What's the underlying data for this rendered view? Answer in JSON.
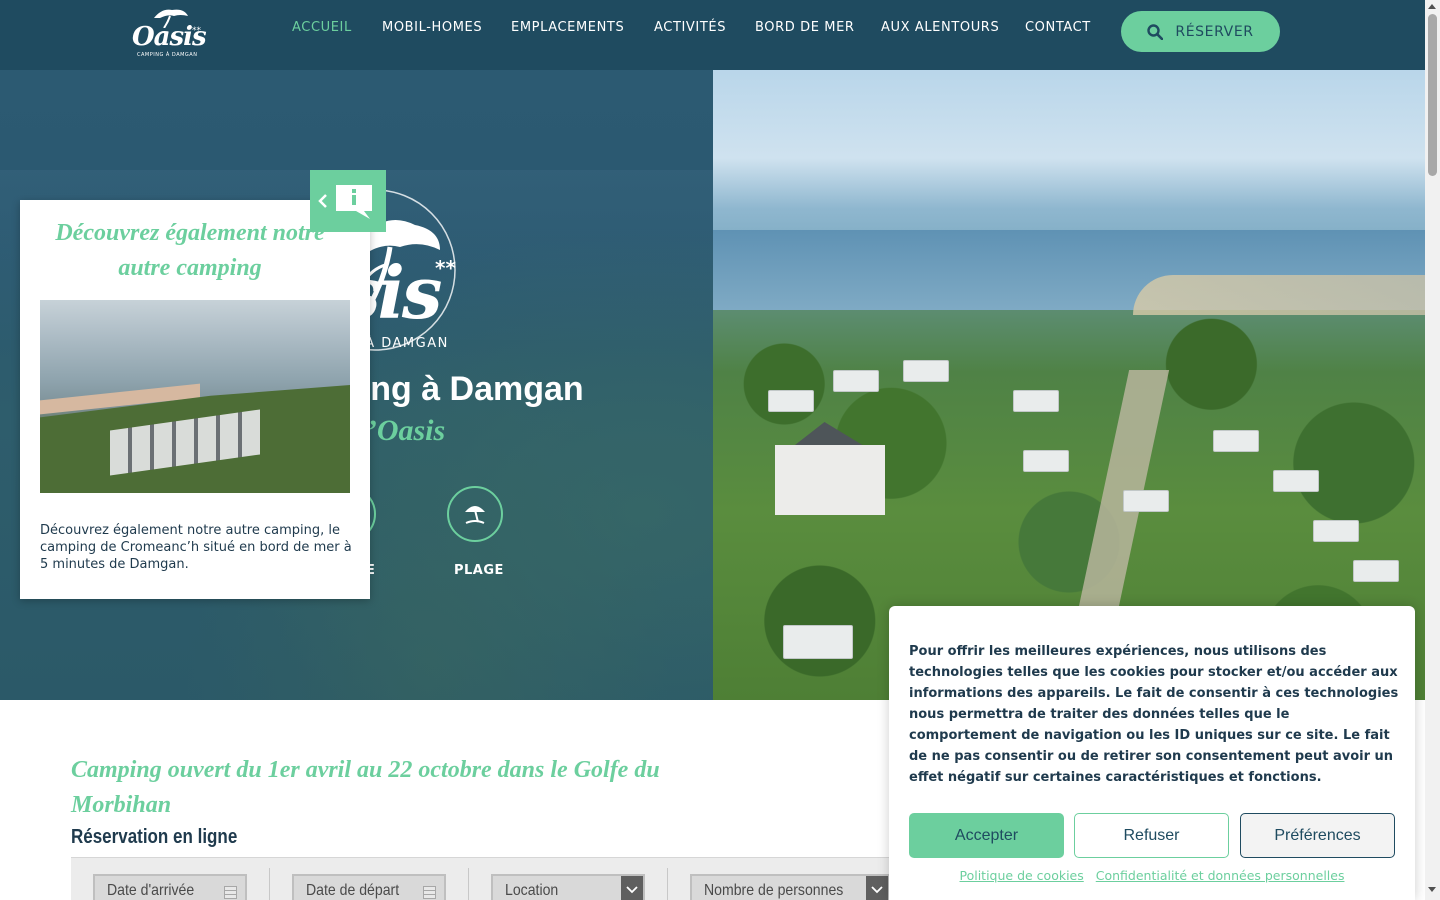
{
  "header": {
    "logo": {
      "word": "Oasis",
      "stars": "**",
      "sub": "CAMPING À DAMGAN"
    },
    "nav": [
      {
        "label": "ACCUEIL",
        "active": true
      },
      {
        "label": "MOBIL-HOMES",
        "active": false
      },
      {
        "label": "EMPLACEMENTS",
        "active": false
      },
      {
        "label": "ACTIVITÉS",
        "active": false
      },
      {
        "label": "BORD DE MER",
        "active": false
      },
      {
        "label": "AUX ALENTOURS",
        "active": false
      },
      {
        "label": "CONTACT",
        "active": false
      }
    ],
    "reserve_label": "RÉSERVER",
    "reserve_icon": "search-icon"
  },
  "hero": {
    "logo_word": "sis",
    "logo_stars": "**",
    "logo_sub": "G À DAMGAN",
    "title": "ping à Damgan",
    "subtitle": "g l’Oasis",
    "features": [
      {
        "label": "E",
        "icon": "partial-icon"
      },
      {
        "label": "PLAGE",
        "icon": "beach-umbrella-icon"
      }
    ]
  },
  "popup": {
    "title": "Découvrez également notre autre camping",
    "text": "Découvrez également notre autre camping, le camping de Cromeanc’h situé en bord de mer à 5 minutes de Damgan.",
    "toggle_icons": [
      "chevron-left-icon",
      "info-bubble-icon"
    ]
  },
  "main": {
    "open_text": "Camping ouvert du 1er avril au 22 octobre dans le Golfe du Morbihan",
    "booking_title": "Réservation en ligne",
    "booking_fields": [
      {
        "label": "Date d'arrivée",
        "icon": "calendar-icon"
      },
      {
        "label": "Date de départ",
        "icon": "calendar-icon"
      },
      {
        "label": "Location",
        "icon": "chevron-down-icon"
      },
      {
        "label": "Nombre de personnes",
        "icon": "chevron-down-icon"
      }
    ]
  },
  "cookie": {
    "text": "Pour offrir les meilleures expériences, nous utilisons des technologies telles que les cookies pour stocker et/ou accéder aux informations des appareils. Le fait de consentir à ces technologies nous permettra de traiter des données telles que le comportement de navigation ou les ID uniques sur ce site. Le fait de ne pas consentir ou de retirer son consentement peut avoir un effet négatif sur certaines caractéristiques et fonctions.",
    "accept": "Accepter",
    "refuse": "Refuser",
    "prefs": "Préférences",
    "link_policy": "Politique de cookies",
    "link_privacy": "Confidentialité et données personnelles"
  },
  "colors": {
    "header_bg": "#1f4b60",
    "accent_green": "#6ccf9e",
    "text_dark": "#1f3a4d"
  }
}
